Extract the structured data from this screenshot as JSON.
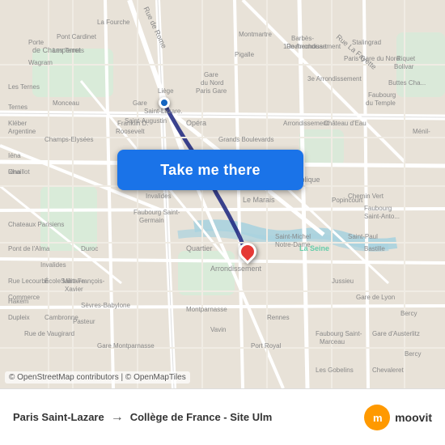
{
  "map": {
    "attribution": "© OpenStreetMap contributors | © OpenMapTiles",
    "center": {
      "lat": 48.855,
      "lng": 2.345
    }
  },
  "button": {
    "label": "Take me there"
  },
  "footer": {
    "from": "Paris Saint-Lazare",
    "arrow": "→",
    "to": "Collège de France - Site Ulm"
  },
  "logo": {
    "name": "moovit",
    "icon": "m",
    "text": "moovit"
  },
  "streets": {
    "bg_light": "#f5f0e8",
    "bg_park": "#c8e6c9",
    "road_major": "#ffffff",
    "road_minor": "#eeeeee",
    "water": "#aad3df",
    "text_color": "#666666"
  }
}
